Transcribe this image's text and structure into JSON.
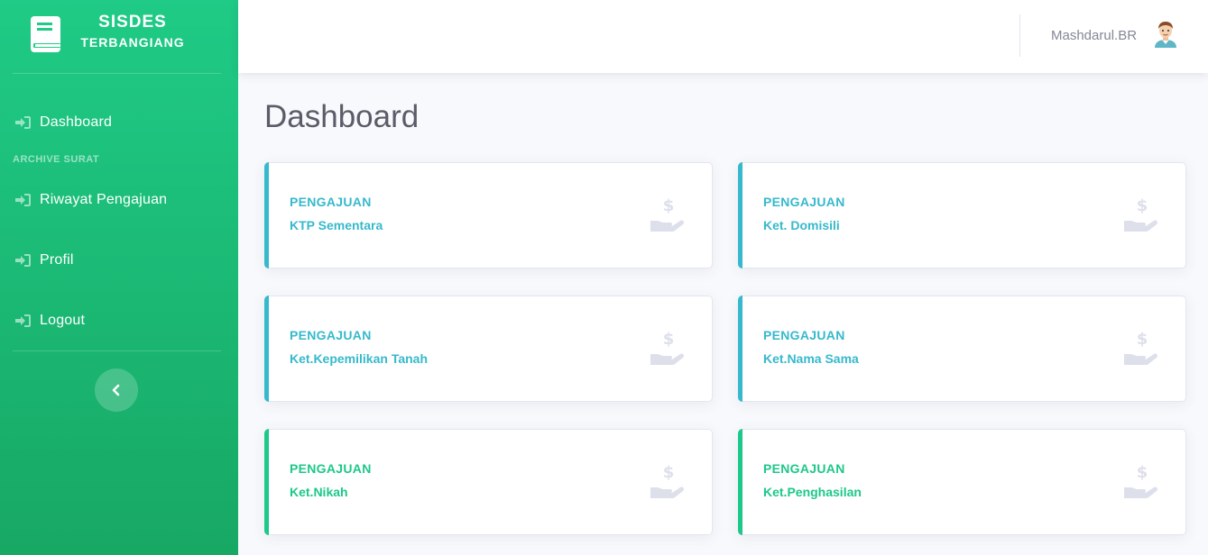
{
  "brand": {
    "line1": "SISDES",
    "line2": "TERBANGIANG"
  },
  "sidebar": {
    "items": [
      {
        "label": "Dashboard",
        "icon": "sign-in-icon"
      },
      {
        "label": "Riwayat Pengajuan",
        "icon": "sign-in-icon"
      },
      {
        "label": "Profil",
        "icon": "sign-in-icon"
      },
      {
        "label": "Logout",
        "icon": "sign-in-icon"
      }
    ],
    "section_heading": "ARCHIVE SURAT",
    "toggle_icon": "chevron-left-icon"
  },
  "topbar": {
    "user_name": "Mashdarul.BR",
    "avatar_icon": "user-avatar-icon"
  },
  "page": {
    "title": "Dashboard"
  },
  "cards": [
    {
      "kicker": "PENGAJUAN",
      "subject": "KTP Sementara",
      "icon": "hand-holding-usd-icon",
      "color": "#36b9cc"
    },
    {
      "kicker": "PENGAJUAN",
      "subject": "Ket. Domisili",
      "icon": "hand-holding-usd-icon",
      "color": "#36b9cc"
    },
    {
      "kicker": "PENGAJUAN",
      "subject": "Ket.Kepemilikan Tanah",
      "icon": "hand-holding-usd-icon",
      "color": "#36b9cc"
    },
    {
      "kicker": "PENGAJUAN",
      "subject": "Ket.Nama Sama",
      "icon": "hand-holding-usd-icon",
      "color": "#36b9cc"
    },
    {
      "kicker": "PENGAJUAN",
      "subject": "Ket.Nikah",
      "icon": "hand-holding-usd-icon",
      "color": "#1cc88a"
    },
    {
      "kicker": "PENGAJUAN",
      "subject": "Ket.Penghasilan",
      "icon": "hand-holding-usd-icon",
      "color": "#1cc88a"
    }
  ],
  "colors": {
    "sidebar_top": "#1fcb86",
    "sidebar_bottom": "#17a864",
    "info": "#36b9cc",
    "success": "#1cc88a",
    "title": "#5a5c69"
  }
}
